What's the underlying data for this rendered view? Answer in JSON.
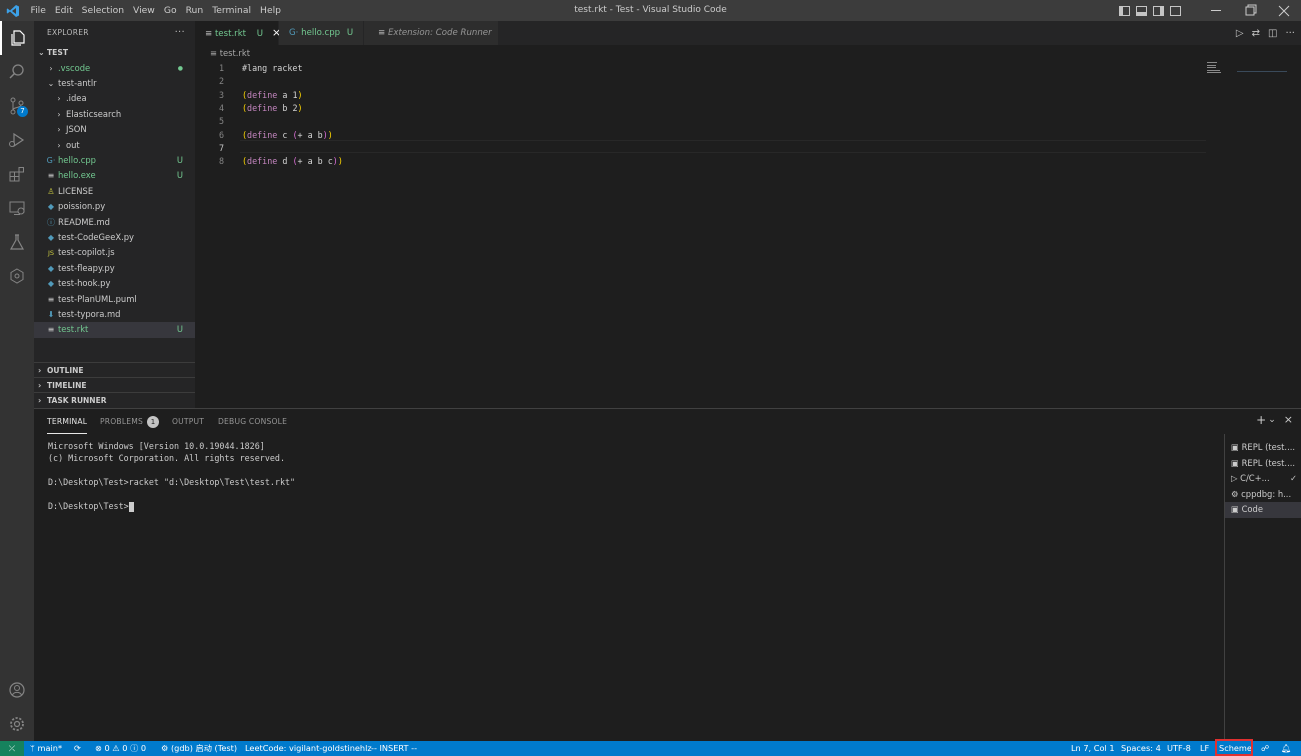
{
  "titlebar": {
    "menu": [
      "File",
      "Edit",
      "Selection",
      "View",
      "Go",
      "Run",
      "Terminal",
      "Help"
    ],
    "title": "test.rkt - Test - Visual Studio Code"
  },
  "activity": {
    "scm_badge": "7"
  },
  "explorer": {
    "header": "EXPLORER",
    "root": "TEST",
    "items": [
      {
        "label": ".vscode",
        "kind": "folder",
        "status": "●",
        "color": "#73c991"
      },
      {
        "label": "test-antlr",
        "kind": "folder-open",
        "status": "",
        "color": "#cccccc"
      },
      {
        "label": ".idea",
        "kind": "folder",
        "status": "",
        "color": "#cccccc"
      },
      {
        "label": "Elasticsearch",
        "kind": "folder",
        "status": "",
        "color": "#cccccc"
      },
      {
        "label": "JSON",
        "kind": "folder",
        "status": "",
        "color": "#cccccc"
      },
      {
        "label": "out",
        "kind": "folder",
        "status": "",
        "color": "#cccccc"
      },
      {
        "label": "hello.cpp",
        "kind": "file",
        "icon": "G·",
        "status": "U",
        "color": "#73c991"
      },
      {
        "label": "hello.exe",
        "kind": "file",
        "icon": "≡",
        "status": "U",
        "color": "#73c991"
      },
      {
        "label": "LICENSE",
        "kind": "file",
        "icon": "♙",
        "status": "",
        "color": "#cccccc"
      },
      {
        "label": "poission.py",
        "kind": "file",
        "icon": "◆",
        "status": "",
        "color": "#cccccc"
      },
      {
        "label": "README.md",
        "kind": "file",
        "icon": "ⓘ",
        "status": "",
        "color": "#cccccc"
      },
      {
        "label": "test-CodeGeeX.py",
        "kind": "file",
        "icon": "◆",
        "status": "",
        "color": "#cccccc"
      },
      {
        "label": "test-copilot.js",
        "kind": "file",
        "icon": "JS",
        "status": "",
        "color": "#cccccc"
      },
      {
        "label": "test-fleapy.py",
        "kind": "file",
        "icon": "◆",
        "status": "",
        "color": "#cccccc"
      },
      {
        "label": "test-hook.py",
        "kind": "file",
        "icon": "◆",
        "status": "",
        "color": "#cccccc"
      },
      {
        "label": "test-PlanUML.puml",
        "kind": "file",
        "icon": "≡",
        "status": "",
        "color": "#cccccc"
      },
      {
        "label": "test-typora.md",
        "kind": "file",
        "icon": "⬇",
        "status": "",
        "color": "#cccccc"
      },
      {
        "label": "test.rkt",
        "kind": "file",
        "icon": "≡",
        "status": "U",
        "color": "#73c991"
      }
    ],
    "sections": [
      "OUTLINE",
      "TIMELINE",
      "TASK RUNNER"
    ]
  },
  "tabs": [
    {
      "label": "test.rkt",
      "status": "U",
      "close": "×"
    },
    {
      "label": "hello.cpp",
      "status": "U"
    },
    {
      "label": "Extension: Code Runner"
    }
  ],
  "breadcrumb": "test.rkt",
  "editor": {
    "lines": [
      {
        "n": "1",
        "text": "#lang racket"
      },
      {
        "n": "2",
        "text": ""
      },
      {
        "n": "3",
        "text": "(define a 1)"
      },
      {
        "n": "4",
        "text": "(define b 2)"
      },
      {
        "n": "5",
        "text": ""
      },
      {
        "n": "6",
        "text": "(define c (+ a b))"
      },
      {
        "n": "7",
        "text": ""
      },
      {
        "n": "8",
        "text": "(define d (+ a b c))"
      }
    ]
  },
  "panel": {
    "tabs": [
      "TERMINAL",
      "PROBLEMS",
      "OUTPUT",
      "DEBUG CONSOLE"
    ],
    "problems_count": "1",
    "terminal_lines": [
      "Microsoft Windows [Version 10.0.19044.1826]",
      "(c) Microsoft Corporation. All rights reserved.",
      "",
      "D:\\Desktop\\Test>racket \"d:\\Desktop\\Test\\test.rkt\"",
      "",
      "D:\\Desktop\\Test>"
    ],
    "terminals": [
      "REPL (test....",
      "REPL (test....",
      "C/C+...",
      "cppdbg: h...",
      "Code"
    ]
  },
  "status": {
    "branch": "main*",
    "errors": "0",
    "warnings": "0",
    "info": "0",
    "launch": "(gdb) 启动 (Test)",
    "leetcode": "LeetCode: vigilant-goldstinehlz",
    "vim": "-- INSERT --",
    "position": "Ln 7, Col 1",
    "spaces": "Spaces: 4",
    "encoding": "UTF-8",
    "eol": "LF",
    "language": "Scheme"
  },
  "colors": {
    "accent": "#007acc",
    "remote": "#16825d",
    "git_untracked": "#73c991",
    "highlight_box": "#e03030"
  }
}
